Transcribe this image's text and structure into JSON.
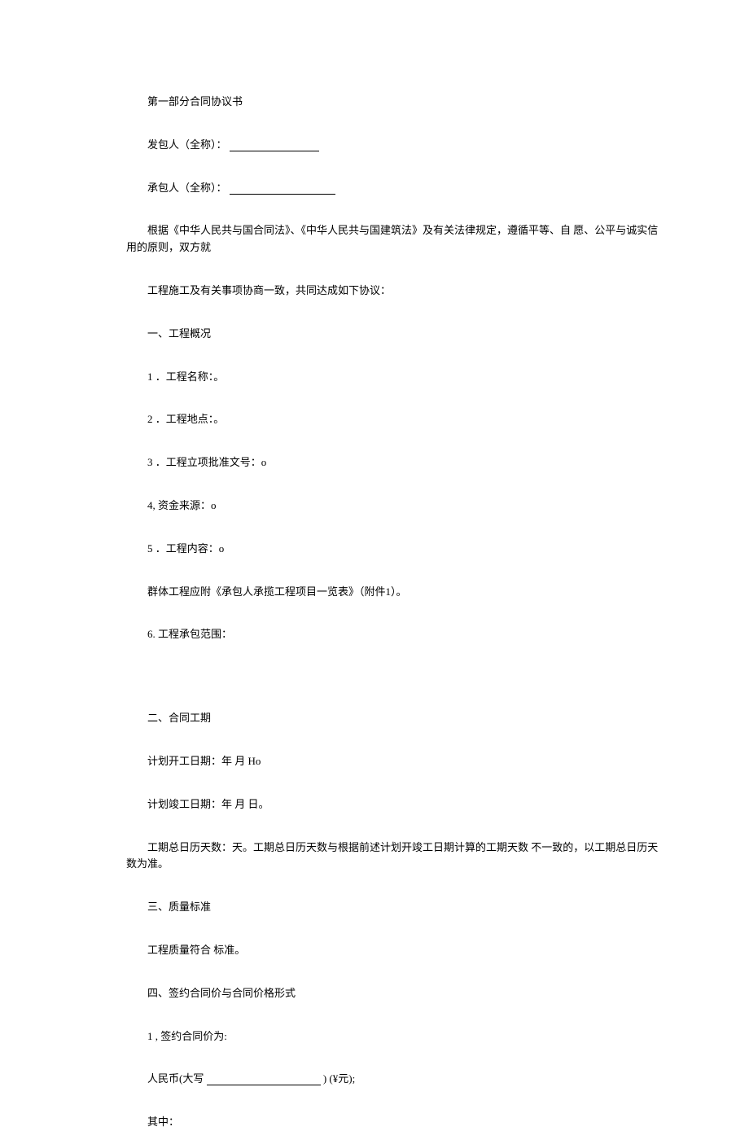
{
  "title": "第一部分合同协议书",
  "party_a_label": "发包人（全称）：",
  "party_b_label": "承包人（全称）：",
  "preamble_1": "根据《中华人民共与国合同法》、《中华人民共与国建筑法》及有关法律规定，遵循平等、自 愿、公平与诚实信用的原则，双方就",
  "preamble_2": "工程施工及有关事项协商一致，共同达成如下协议：",
  "section1": {
    "heading": "一、工程概况",
    "items": [
      "1 ．工程名称：。",
      "2 ．工程地点：。",
      "3 ．工程立项批准文号：o",
      "4, 资金来源：o",
      "5 ．工程内容：o"
    ],
    "note": "群体工程应附《承包人承揽工程项目一览表》（附件1）。",
    "item6": "6. 工程承包范围："
  },
  "section2": {
    "heading": "二、合同工期",
    "start_date": "计划开工日期：年 月 Ho",
    "end_date": "计划竣工日期：年 月 日。",
    "duration": "工期总日历天数：天。工期总日历天数与根据前述计划开竣工日期计算的工期天数 不一致的，以工期总日历天数为准。"
  },
  "section3": {
    "heading": "三、质量标准",
    "content": "工程质量符合 标准。"
  },
  "section4": {
    "heading": "四、签约合同价与合同价格形式",
    "item1_label": "1 , 签约合同价为:",
    "rmb_prefix": "人民币(大写",
    "rmb_suffix": ") (¥元);",
    "sub_label": "其中："
  }
}
